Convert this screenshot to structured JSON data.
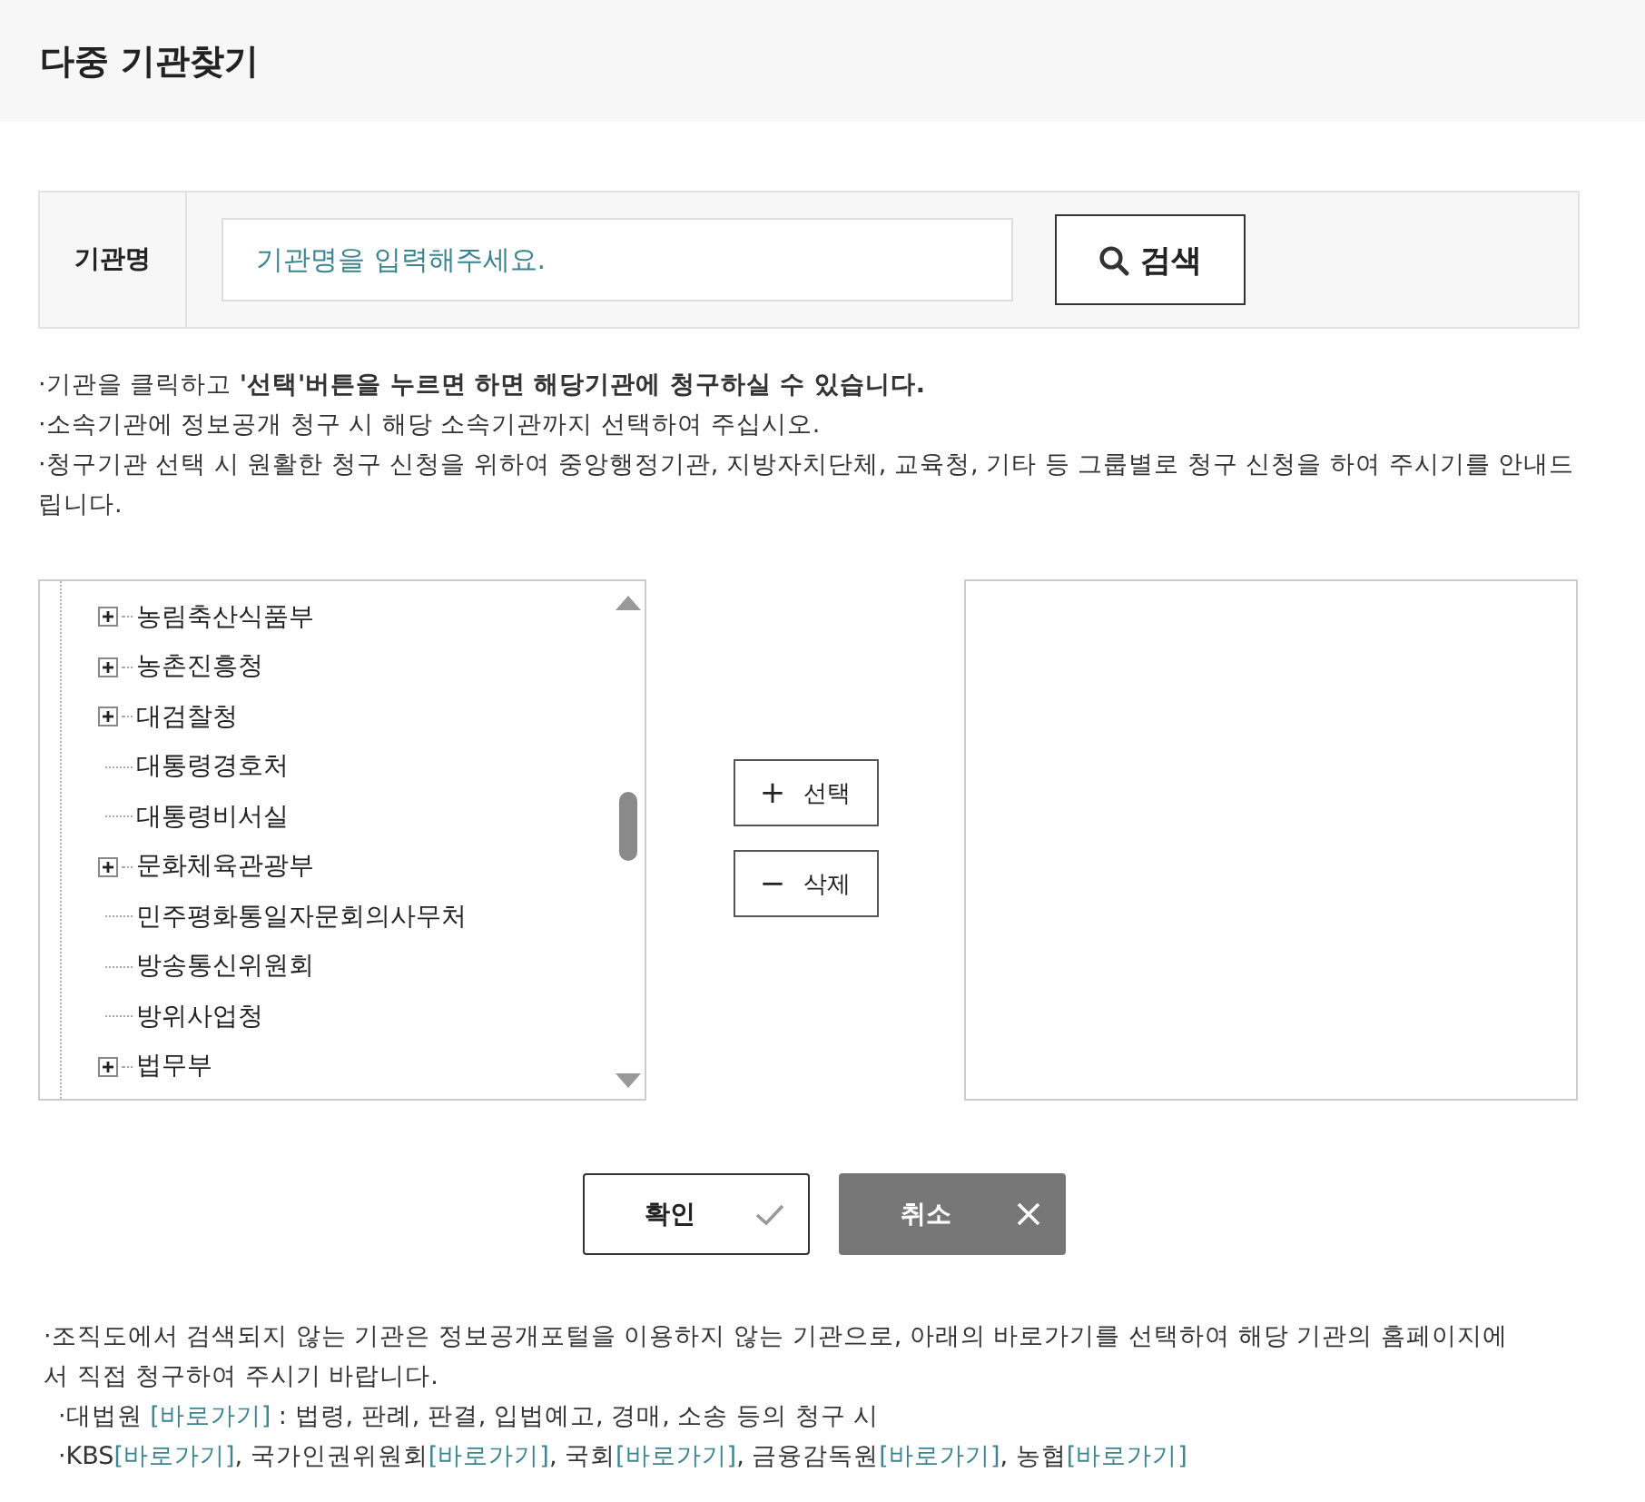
{
  "title": "다중 기관찾기",
  "search": {
    "label": "기관명",
    "placeholder": "기관명을 입력해주세요.",
    "button": "검색"
  },
  "notes": [
    "·기관을 클릭하고 **'선택'버튼을 누르면 하면 해당기관에 청구하실 수 있습니다.**",
    "·소속기관에 정보공개 청구 시 해당 소속기관까지 선택하여 주십시오.",
    "·청구기관 선택 시 원활한 청구 신청을 위하여 중앙행정기관, 지방자치단체, 교육청, 기타 등 그룹별로 청구 신청을 하여 주시기를 안내드립니다."
  ],
  "tree": [
    {
      "label": "농림축산식품부",
      "kind": "group",
      "expanded": false
    },
    {
      "label": "농촌진흥청",
      "kind": "group",
      "expanded": false
    },
    {
      "label": "대검찰청",
      "kind": "group",
      "expanded": false
    },
    {
      "label": "대통령경호처",
      "kind": "leaf"
    },
    {
      "label": "대통령비서실",
      "kind": "leaf"
    },
    {
      "label": "문화체육관광부",
      "kind": "group",
      "expanded": false
    },
    {
      "label": "민주평화통일자문회의사무처",
      "kind": "leaf"
    },
    {
      "label": "방송통신위원회",
      "kind": "leaf"
    },
    {
      "label": "방위사업청",
      "kind": "leaf"
    },
    {
      "label": "법무부",
      "kind": "group",
      "expanded": false
    }
  ],
  "move_buttons": [
    {
      "icon": "+",
      "label": "선택"
    },
    {
      "icon": "−",
      "label": "삭제"
    }
  ],
  "actions": [
    {
      "label": "확인",
      "kind": "confirm"
    },
    {
      "label": "취소",
      "kind": "cancel"
    }
  ],
  "footer": {
    "intro": "·조직도에서 검색되지 않는 기관은 정보공개포털을 이용하지 않는 기관으로, 아래의 바로가기를 선택하여 해당 기관의 홈페이지에서 직접 청구하여 주시기 바랍니다.",
    "lines": [
      [
        {
          "kind": "text",
          "text": "·대법원 "
        },
        {
          "kind": "link",
          "text": "[바로가기]"
        },
        {
          "kind": "text",
          "text": " : 법령, 판례, 판결, 입법예고, 경매, 소송 등의 청구 시"
        }
      ],
      [
        {
          "kind": "text",
          "text": "·KBS"
        },
        {
          "kind": "link",
          "text": "[바로가기]"
        },
        {
          "kind": "text",
          "text": ", 국가인권위원회"
        },
        {
          "kind": "link",
          "text": "[바로가기]"
        },
        {
          "kind": "text",
          "text": ", 국회"
        },
        {
          "kind": "link",
          "text": "[바로가기]"
        },
        {
          "kind": "text",
          "text": ", 금융감독원"
        },
        {
          "kind": "link",
          "text": "[바로가기]"
        },
        {
          "kind": "text",
          "text": ", 농협"
        },
        {
          "kind": "link",
          "text": "[바로가기]"
        }
      ]
    ]
  }
}
